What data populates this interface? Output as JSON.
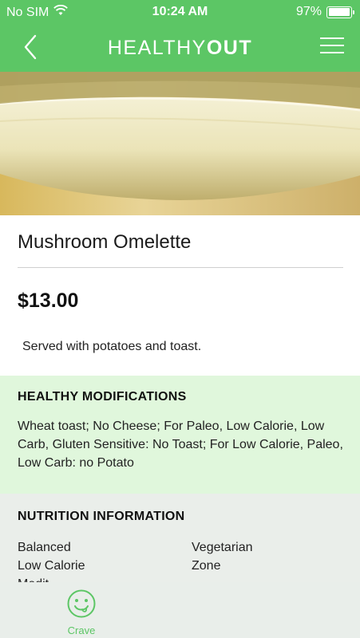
{
  "status_bar": {
    "carrier": "No SIM",
    "time": "10:24 AM",
    "battery_text": "97%",
    "battery_level_percent": 97
  },
  "nav": {
    "brand_light": "HEALTHY",
    "brand_bold": "OUT",
    "back_icon": "chevron-left-icon",
    "menu_icon": "hamburger-icon"
  },
  "item": {
    "title": "Mushroom Omelette",
    "price": "$13.00",
    "description": "Served with potatoes and toast."
  },
  "healthy_modifications": {
    "heading": "HEALTHY MODIFICATIONS",
    "text": "Wheat toast; No Cheese; For Paleo, Low Calorie, Low Carb, Gluten Sensitive: No Toast; For Low Calorie, Paleo, Low Carb: no Potato"
  },
  "nutrition": {
    "heading": "NUTRITION INFORMATION",
    "tags": [
      "Balanced",
      "Vegetarian",
      "Low Calorie",
      "Zone",
      "Medit"
    ]
  },
  "tabbar": {
    "crave_label": "Crave",
    "crave_icon": "smiley-face-icon"
  },
  "colors": {
    "brand_green": "#5cc665",
    "modifications_bg": "#e0f7dc",
    "nutrition_bg": "#eaeeea"
  }
}
